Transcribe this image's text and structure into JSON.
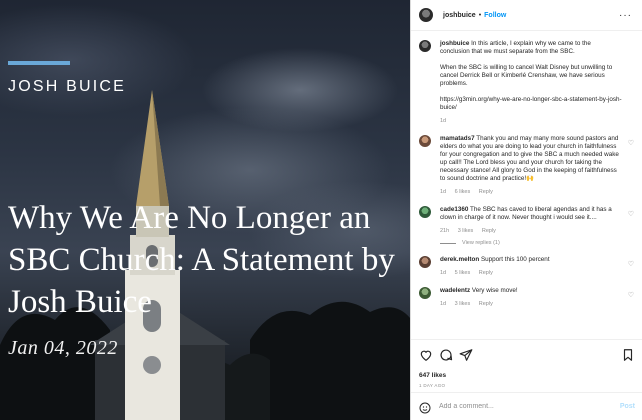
{
  "post_image": {
    "author_caps": "JOSH BUICE",
    "headline": "Why We Are No Longer an SBC Church: A Statement by Josh Buice",
    "date": "Jan 04, 2022"
  },
  "header": {
    "username": "joshbuice",
    "separator": "•",
    "follow_label": "Follow",
    "more_icon": "more-horizontal-icon"
  },
  "caption": {
    "username": "joshbuice",
    "paragraph1": "In this article, I explain why we came to the conclusion that we must separate from the SBC.",
    "paragraph2": "When the SBC is willing to cancel Walt Disney but unwilling to cancel Derrick Bell or Kimberlé Crenshaw, we have serious problems.",
    "link": "https://g3min.org/why-we-are-no-longer-sbc-a-statement-by-josh-buice/",
    "time": "1d"
  },
  "comments": [
    {
      "username": "mamatads7",
      "text": "Thank you and may many more sound pastors and elders do what you are doing to lead your church in faithfulness for your congregation and to give the SBC a much needed wake up call!! The Lord bless you and your church for taking the necessary stance! All glory to God in the keeping of faithfulness to sound doctrine and practice!🙌",
      "time": "1d",
      "likes": "6 likes",
      "reply": "Reply"
    },
    {
      "username": "cade1360",
      "text": "The SBC has caved to liberal agendas and it has a clown in charge of it now. Never thought i would see it....",
      "time": "21h",
      "likes": "3 likes",
      "reply": "Reply",
      "view_replies": "View replies (1)"
    },
    {
      "username": "derek.melton",
      "text": "Support this 100 percent",
      "time": "1d",
      "likes": "5 likes",
      "reply": "Reply"
    },
    {
      "username": "wadelentz",
      "text": "Very wise move!",
      "time": "1d",
      "likes": "3 likes",
      "reply": "Reply"
    }
  ],
  "actions": {
    "likes": "647 likes",
    "time_ago": "1 DAY AGO"
  },
  "add_comment": {
    "placeholder": "Add a comment...",
    "post_label": "Post"
  },
  "colors": {
    "link_blue": "#0095f6",
    "accent_bar": "#6aa8d8",
    "muted": "#8e8e8e"
  }
}
